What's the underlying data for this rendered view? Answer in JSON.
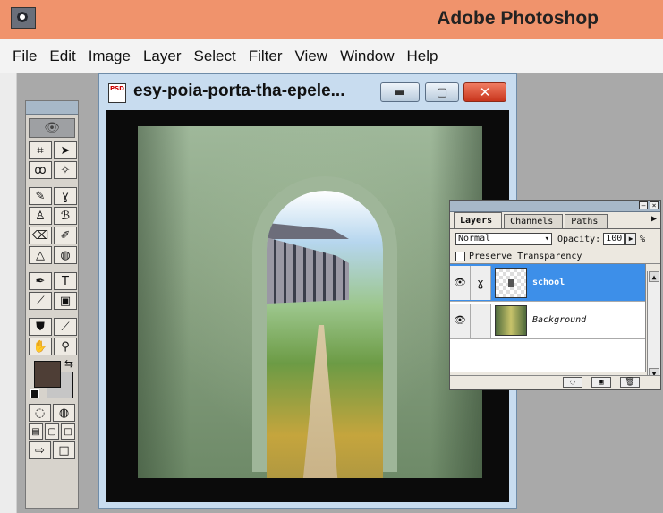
{
  "app": {
    "title": "Adobe Photoshop"
  },
  "menu": [
    "File",
    "Edit",
    "Image",
    "Layer",
    "Select",
    "Filter",
    "View",
    "Window",
    "Help"
  ],
  "document": {
    "title": "esy-poia-porta-tha-epele..."
  },
  "toolbox": {
    "tools": [
      {
        "name": "crop-tool",
        "glyph": "⌗"
      },
      {
        "name": "move-tool",
        "glyph": "➤"
      },
      {
        "name": "lasso-tool",
        "glyph": "ꝏ"
      },
      {
        "name": "magic-wand-tool",
        "glyph": "✧"
      },
      {
        "name": "airbrush-tool",
        "glyph": "✎"
      },
      {
        "name": "paintbrush-tool",
        "glyph": "ɣ"
      },
      {
        "name": "rubber-stamp-tool",
        "glyph": "♙"
      },
      {
        "name": "history-brush-tool",
        "glyph": "ℬ"
      },
      {
        "name": "eraser-tool",
        "glyph": "⌫"
      },
      {
        "name": "pencil-tool",
        "glyph": "✐"
      },
      {
        "name": "blur-tool",
        "glyph": "△"
      },
      {
        "name": "dodge-tool",
        "glyph": "◍"
      },
      {
        "name": "pen-tool",
        "glyph": "✒"
      },
      {
        "name": "type-tool",
        "glyph": "T"
      },
      {
        "name": "measure-tool",
        "glyph": "⟋"
      },
      {
        "name": "gradient-tool",
        "glyph": "▣"
      },
      {
        "name": "paint-bucket-tool",
        "glyph": "⛊"
      },
      {
        "name": "eyedropper-tool",
        "glyph": "⟋"
      },
      {
        "name": "hand-tool",
        "glyph": "✋"
      },
      {
        "name": "zoom-tool",
        "glyph": "⚲"
      }
    ],
    "foreground_color": "#4e3e36",
    "background_color": "#c6c6c6"
  },
  "layers_panel": {
    "tabs": [
      "Layers",
      "Channels",
      "Paths"
    ],
    "blend_mode": "Normal",
    "opacity_label": "Opacity:",
    "opacity_value": "100",
    "opacity_unit": "%",
    "preserve_transparency": "Preserve Transparency",
    "layers": [
      {
        "name": "school",
        "selected": true
      },
      {
        "name": "Background",
        "selected": false
      }
    ]
  },
  "colors": {
    "accent": "#3d8fe9",
    "app_titlebar": "#f0936c"
  }
}
